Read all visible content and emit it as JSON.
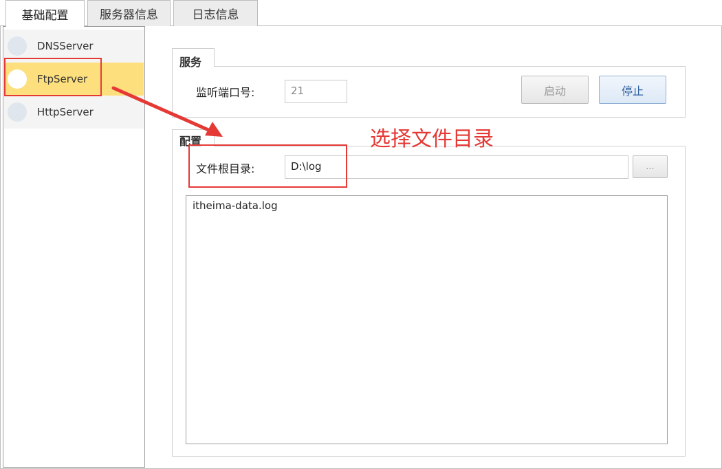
{
  "tabs": [
    {
      "label": "基础配置"
    },
    {
      "label": "服务器信息"
    },
    {
      "label": "日志信息"
    }
  ],
  "sidebar": {
    "items": [
      {
        "label": "DNSServer",
        "selected": false
      },
      {
        "label": "FtpServer",
        "selected": true
      },
      {
        "label": "HttpServer",
        "selected": false
      }
    ]
  },
  "service": {
    "group_title": "服务",
    "port_label": "监听端口号:",
    "port_value": "21",
    "start_label": "启动",
    "stop_label": "停止"
  },
  "config": {
    "group_title": "配置",
    "root_dir_label": "文件根目录:",
    "root_dir_value": "D:\\log",
    "browse_label": "...",
    "files": [
      "itheima-data.log"
    ]
  },
  "annotation": {
    "text": "选择文件目录",
    "color": "#e53935"
  },
  "colors": {
    "selected_item": "#fde07d",
    "accent": "#e53935"
  }
}
